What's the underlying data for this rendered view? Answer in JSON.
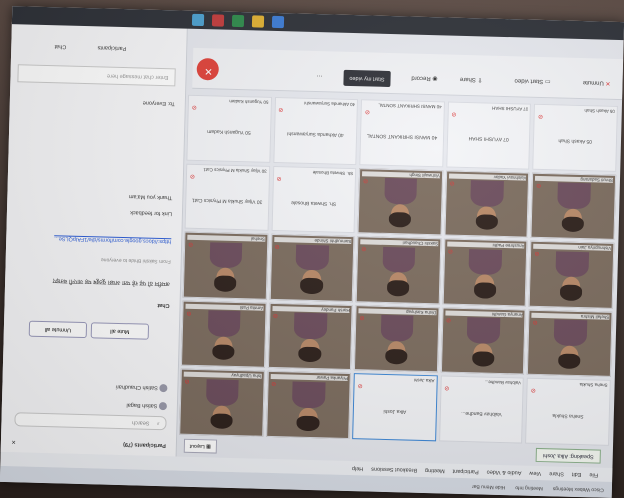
{
  "titlebar": {
    "app": "Cisco Webex Meetings",
    "items": [
      "Meeting Info",
      "Hide Menu Bar"
    ]
  },
  "menubar": {
    "items": [
      "File",
      "Edit",
      "Share",
      "View",
      "Audio & Video",
      "Participant",
      "Meeting",
      "Breakout Sessions",
      "Help"
    ]
  },
  "speaking": "Speaking: Alka Joshi",
  "layout_label": "Layout",
  "tiles": [
    {
      "name": "Sneha Shukla",
      "video": false
    },
    {
      "name": "Vaibhav Bandhe...",
      "video": false
    },
    {
      "name": "Alka Joshi",
      "video": false,
      "active": true
    },
    {
      "name": "Priyanka Pawar",
      "video": true
    },
    {
      "name": "Isha Upadhyay",
      "video": true
    },
    {
      "name": "Shefali Mishra",
      "video": true
    },
    {
      "name": "Ananya Gandhi",
      "video": true
    },
    {
      "name": "Disha Kashyap",
      "video": true
    },
    {
      "name": "Harsh Pandey",
      "video": true
    },
    {
      "name": "Amrita Patil",
      "video": true
    },
    {
      "name": "Vishnupriya Jain",
      "video": true
    },
    {
      "name": "Anushree Padhi",
      "video": true
    },
    {
      "name": "Sakshi Chaudhari",
      "video": true
    },
    {
      "name": "Samrudhhi Shinde",
      "video": true
    },
    {
      "name": "Snehal",
      "video": true
    },
    {
      "name": "Shruti Sadarang",
      "video": true
    },
    {
      "name": "Vaishnavi Yadav",
      "video": true
    },
    {
      "name": "Vishwajit Singh",
      "video": true
    },
    {
      "name": "Sh. Shweta Bhosale",
      "video": false
    },
    {
      "name": "30 Vijay Shukla M Physics Cat1",
      "video": false
    },
    {
      "name": "05 Akash Shah",
      "video": false
    },
    {
      "name": "07 AYUSHI SHAH",
      "video": false
    },
    {
      "name": "40 MANSI SHRIKANT SONTAL",
      "video": false
    },
    {
      "name": "40 Akhanda Suryawanshi",
      "video": false
    },
    {
      "name": "50 Yugansh Kadam",
      "video": false
    }
  ],
  "bottombar": {
    "unmute": "Unmute",
    "start_video": "Start video",
    "share": "Share",
    "record": "Record",
    "start_my_video": "Start my video"
  },
  "sidebar": {
    "participants_header": "Participants (79)",
    "search_placeholder": "Search",
    "participants": [
      "Satish Bagal",
      "Satish Chaudhari"
    ],
    "mute_all": "Mute all",
    "unmute_all": "Unmute all",
    "chat_header": "Chat",
    "messages": [
      "अमरीन ठो पढ़ रहे पता अच्छा यूट्यूब यह जाएगी बताइए",
      "From Sakshi Bhide to everyone",
      "https://docs.google.com/forms/d/e/1FAIpQLSe...",
      "Link for feedback",
      "Thank you Ma'am"
    ],
    "to_label": "To: Everyone",
    "chat_placeholder": "Enter chat message here",
    "participants_btn": "Participants",
    "chat_btn": "Chat"
  },
  "colors": {
    "accent": "#3b86d6",
    "end_meeting": "#e04038",
    "mic_off": "#dd3333"
  }
}
